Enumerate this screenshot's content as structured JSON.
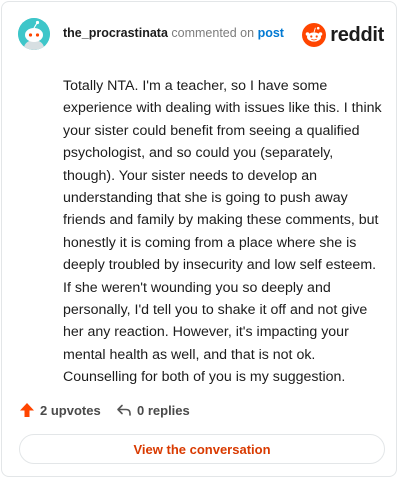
{
  "header": {
    "username": "the_procrastinata",
    "action_text": "commented on",
    "post_link": "post",
    "avatar_icon": "reddit-snoo-avatar-icon",
    "brand_icon": "reddit-logo-icon",
    "brand_word": "reddit"
  },
  "comment": {
    "body": "Totally NTA. I'm a teacher, so I have some experience with dealing with issues like this. I think your sister could benefit from seeing a qualified psychologist, and so could you (separately, though). Your sister needs to develop an understanding that she is going to push away friends and family by making these comments, but honestly it is coming from a place where she is deeply troubled by insecurity and low self esteem. If she weren't wounding you so deeply and personally, I'd tell you to shake it off and not give her any reaction. However, it's impacting your mental health as well, and that is not ok. Counselling for both of you is my suggestion."
  },
  "actions": {
    "upvotes": "2 upvotes",
    "replies": "0 replies",
    "upvote_icon": "upvote-arrow-icon",
    "reply_icon": "reply-arrow-icon"
  },
  "cta": {
    "label": "View the conversation"
  },
  "colors": {
    "accent_orange": "#d93a00",
    "reddit_orange": "#ff4500",
    "link_blue": "#0079d3",
    "avatar_teal": "#3ec6c9"
  }
}
